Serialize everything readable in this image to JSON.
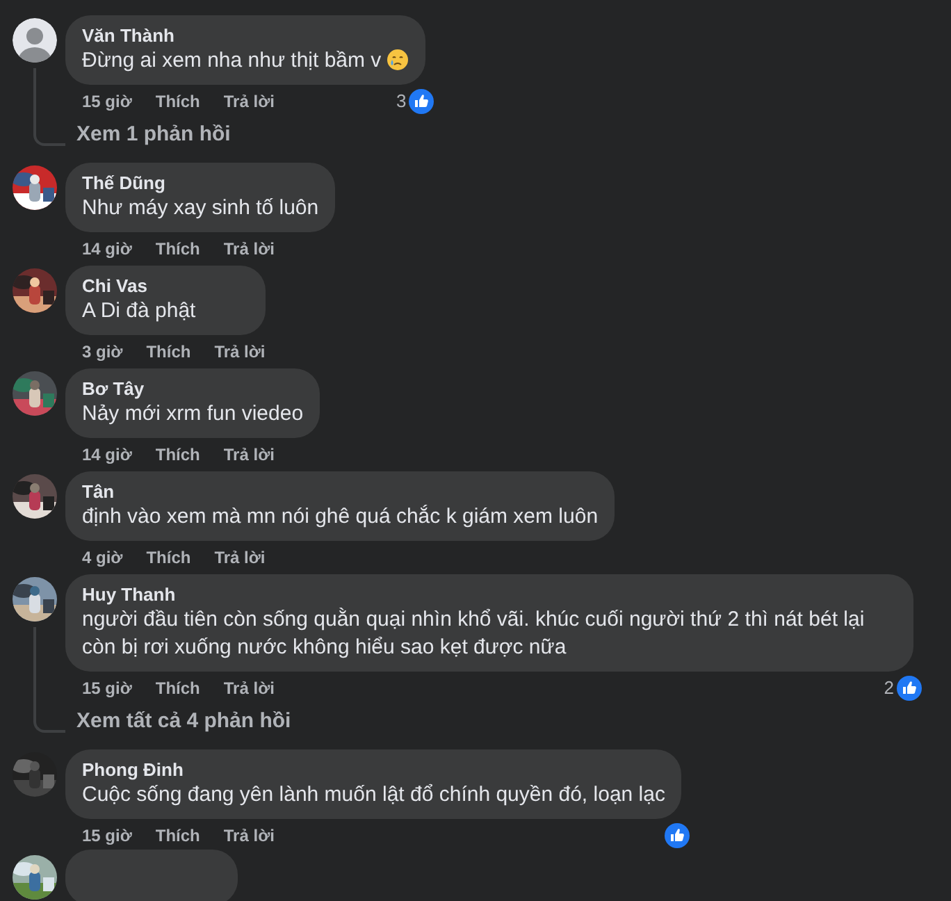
{
  "comments": [
    {
      "kind": "comment",
      "author": "Văn Thành",
      "avatar": {
        "kind": "default"
      },
      "text": "Đừng ai xem nha như thịt bầm v",
      "has_emoji": true,
      "time": "15 giờ",
      "like": "Thích",
      "reply": "Trả lời",
      "reacted": true,
      "reaction_count": "3",
      "replies_link": "Xem 1 phản hồi"
    },
    {
      "kind": "comment",
      "author": "Thế Dũng",
      "text": "Như máy xay sinh tố luôn",
      "time": "14 giờ",
      "like": "Thích",
      "reply": "Trả lời",
      "reacted": false
    },
    {
      "kind": "comment",
      "author": "Chi Vas",
      "text": "A Di đà phật",
      "time": "3 giờ",
      "like": "Thích",
      "reply": "Trả lời",
      "reacted": false
    },
    {
      "kind": "comment",
      "author": "Bơ Tây",
      "text": "Nảy mới xrm fun viedeo",
      "time": "14 giờ",
      "like": "Thích",
      "reply": "Trả lời",
      "reacted": false
    },
    {
      "kind": "comment",
      "author": "Tân",
      "text": "định vào xem mà mn nói ghê quá chắc k giám xem luôn",
      "time": "4 giờ",
      "like": "Thích",
      "reply": "Trả lời",
      "reacted": false
    },
    {
      "kind": "comment",
      "author": "Huy Thanh",
      "text": "người đầu tiên còn sống quằn quại nhìn khổ vãi. khúc cuối người thứ 2 thì nát bét lại còn bị rơi xuống nước không hiểu sao kẹt được nữa",
      "time": "15 giờ",
      "like": "Thích",
      "reply": "Trả lời",
      "reacted": true,
      "reaction_count": "2",
      "replies_link": "Xem tất cả 4 phản hồi"
    },
    {
      "kind": "comment",
      "author": "Phong Đinh",
      "text": "Cuộc sống đang yên lành muốn lật đổ chính quyền đó, loạn lạc",
      "time": "15 giờ",
      "like": "Thích",
      "reply": "Trả lời",
      "reacted": true
    },
    {
      "kind": "partial"
    }
  ]
}
